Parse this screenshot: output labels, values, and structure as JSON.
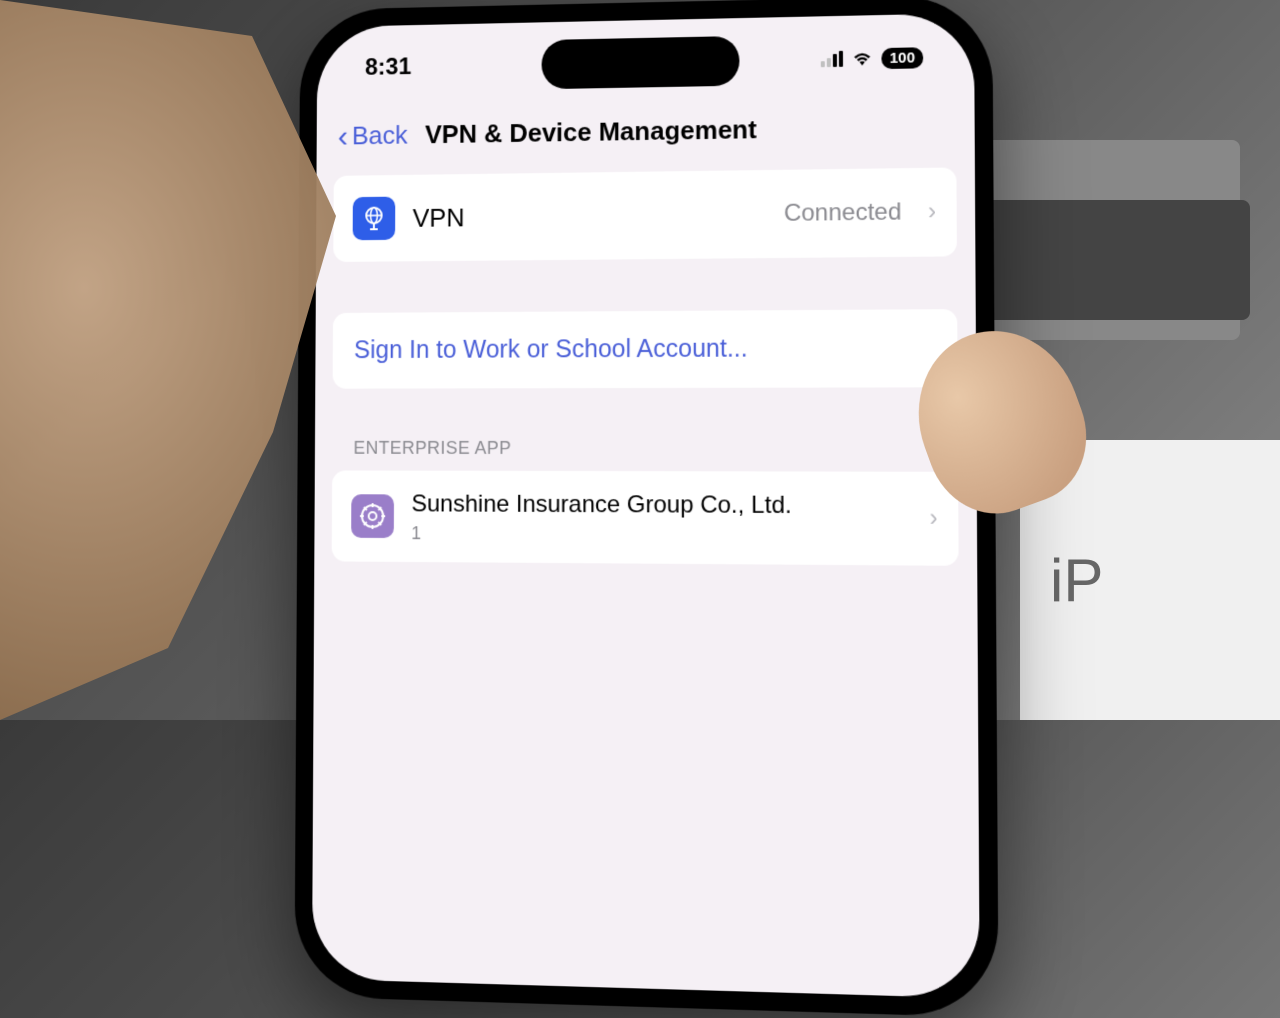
{
  "status_bar": {
    "time": "8:31",
    "battery": "100"
  },
  "nav": {
    "back_label": "Back",
    "title": "VPN & Device Management"
  },
  "vpn": {
    "label": "VPN",
    "status": "Connected"
  },
  "signin": {
    "label": "Sign In to Work or School Account..."
  },
  "enterprise": {
    "section_title": "ENTERPRISE APP",
    "app_name": "Sunshine Insurance Group Co., Ltd.",
    "count": "1"
  },
  "background": {
    "box_text": "iP"
  }
}
